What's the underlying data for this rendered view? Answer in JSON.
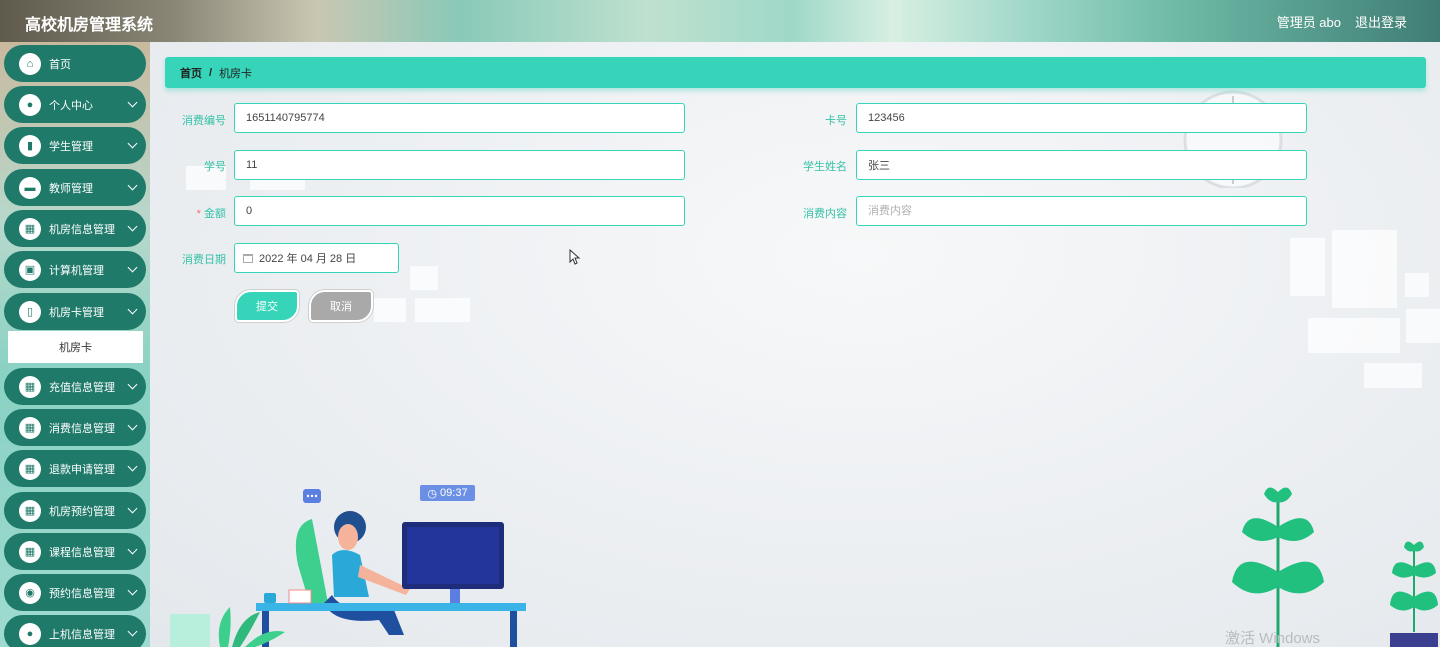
{
  "header": {
    "title": "高校机房管理系统",
    "admin_label": "管理员 abo",
    "logout_label": "退出登录"
  },
  "sidebar": {
    "items": [
      {
        "label": "首页",
        "icon": "home-icon",
        "expandable": false
      },
      {
        "label": "个人中心",
        "icon": "user-icon",
        "expandable": true
      },
      {
        "label": "学生管理",
        "icon": "bar-chart-icon",
        "expandable": true
      },
      {
        "label": "教师管理",
        "icon": "briefcase-icon",
        "expandable": true
      },
      {
        "label": "机房信息管理",
        "icon": "grid-icon",
        "expandable": true
      },
      {
        "label": "计算机管理",
        "icon": "computer-icon",
        "expandable": true
      },
      {
        "label": "机房卡管理",
        "icon": "card-icon",
        "expandable": true
      },
      {
        "label": "充值信息管理",
        "icon": "grid-icon",
        "expandable": true
      },
      {
        "label": "消费信息管理",
        "icon": "grid-icon",
        "expandable": true
      },
      {
        "label": "退款申请管理",
        "icon": "grid-icon",
        "expandable": true
      },
      {
        "label": "机房预约管理",
        "icon": "grid-icon",
        "expandable": true
      },
      {
        "label": "课程信息管理",
        "icon": "grid-icon",
        "expandable": true
      },
      {
        "label": "预约信息管理",
        "icon": "bulb-icon",
        "expandable": true
      },
      {
        "label": "上机信息管理",
        "icon": "user-icon",
        "expandable": true
      }
    ],
    "active_sub_item": "机房卡"
  },
  "breadcrumb": {
    "home": "首页",
    "separator": "/",
    "current": "机房卡"
  },
  "form": {
    "consume_no": {
      "label": "消费编号",
      "value": "1651140795774"
    },
    "card_no": {
      "label": "卡号",
      "value": "123456"
    },
    "student_no": {
      "label": "学号",
      "value": "11"
    },
    "student_name": {
      "label": "学生姓名",
      "value": "张三"
    },
    "amount": {
      "label": "金额",
      "required_mark": "*",
      "value": "0"
    },
    "consume_content": {
      "label": "消费内容",
      "value": "",
      "placeholder": "消费内容"
    },
    "consume_date": {
      "label": "消费日期",
      "value": "2022 年 04 月 28 日"
    },
    "submit_label": "提交",
    "cancel_label": "取消"
  },
  "illustration": {
    "time_badge": "09:37"
  },
  "watermark": "激活 Windows",
  "colors": {
    "accent": "#36d4b8",
    "nav": "#1f7a69",
    "cancel": "#a9a9a9"
  }
}
